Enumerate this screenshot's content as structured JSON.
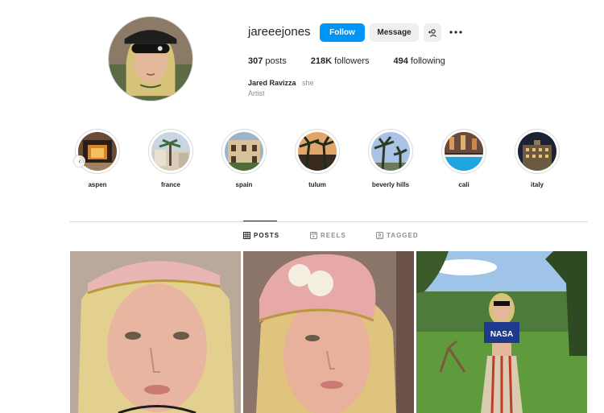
{
  "profile": {
    "username": "jareeejones",
    "follow_label": "Follow",
    "message_label": "Message",
    "stats": {
      "posts_count": "307",
      "posts_label": " posts",
      "followers_count": "218K",
      "followers_label": " followers",
      "following_count": "494",
      "following_label": " following"
    },
    "full_name": "Jared Ravizza",
    "pronoun": "she",
    "category": "Artist"
  },
  "highlights": [
    {
      "label": "aspen",
      "icon": "fireplace-image"
    },
    {
      "label": "france",
      "icon": "palm-street-image"
    },
    {
      "label": "spain",
      "icon": "building-image"
    },
    {
      "label": "tulum",
      "icon": "palm-sunset-image"
    },
    {
      "label": "beverly hills",
      "icon": "palm-trees-image"
    },
    {
      "label": "cali",
      "icon": "pool-image"
    },
    {
      "label": "italy",
      "icon": "hotel-night-image"
    }
  ],
  "tabs": [
    {
      "label": "POSTS",
      "icon": "grid-icon",
      "active": true
    },
    {
      "label": "REELS",
      "icon": "reels-icon",
      "active": false
    },
    {
      "label": "TAGGED",
      "icon": "tagged-icon",
      "active": false
    }
  ],
  "colors": {
    "accent": "#0095f6",
    "button_gray": "#efefef",
    "text_primary": "#262626",
    "text_secondary": "#8e8e8e",
    "border": "#dbdbdb"
  }
}
